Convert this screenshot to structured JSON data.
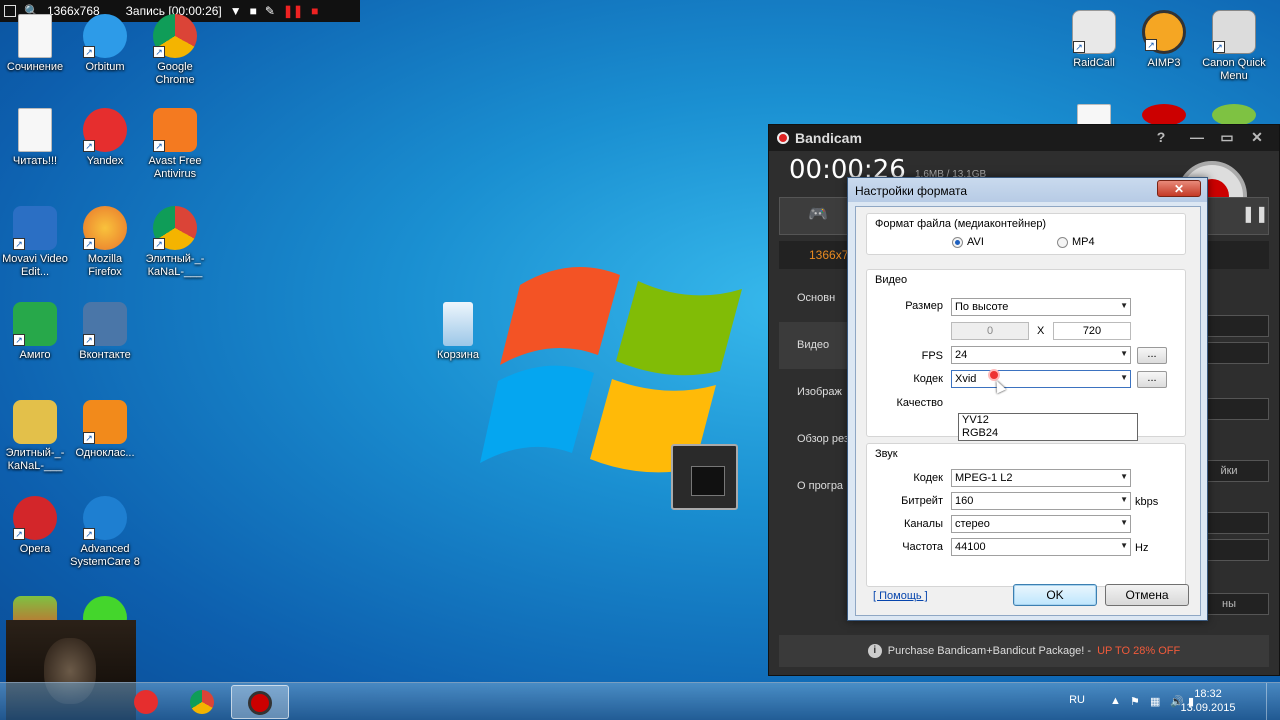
{
  "recorder": {
    "resolution": "1366x768",
    "status": "Запись [00:00:26]"
  },
  "desktop_icons": [
    {
      "label": "Сочинение",
      "icon": "document-icon",
      "color": "#e8eef7"
    },
    {
      "label": "Orbitum",
      "icon": "orbitum-icon",
      "color": "#2d9be8"
    },
    {
      "label": "Google Chrome",
      "icon": "chrome-icon",
      "color": "#3aa757"
    },
    {
      "label": "Читать!!!",
      "icon": "text-file-icon",
      "color": "#f7f7f7"
    },
    {
      "label": "Yandex",
      "icon": "yandex-icon",
      "color": "#e62e2e"
    },
    {
      "label": "Avast Free Antivirus",
      "icon": "avast-icon",
      "color": "#f47a20"
    },
    {
      "label": "Movavi Video Edit...",
      "icon": "movavi-icon",
      "color": "#2b6fc4"
    },
    {
      "label": "Mozilla Firefox",
      "icon": "firefox-icon",
      "color": "#e8752b"
    },
    {
      "label": "Элитный-_-КаNаL-___",
      "icon": "chrome-icon",
      "color": "#3aa757"
    },
    {
      "label": "Амиго",
      "icon": "amigo-icon",
      "color": "#27a84a"
    },
    {
      "label": "Вконтакте",
      "icon": "vk-icon",
      "color": "#4a76a8"
    },
    {
      "label": "Элитный-_-КаNаL-___",
      "icon": "folder-icon",
      "color": "#e3c04a"
    },
    {
      "label": "Однoклас...",
      "icon": "odnoklassniki-icon",
      "color": "#f28a1b"
    },
    {
      "label": "Opera",
      "icon": "opera-icon",
      "color": "#d3262a"
    },
    {
      "label": "Advanced SystemCare 8",
      "icon": "systemcare-icon",
      "color": "#1e7fd1"
    },
    {
      "label": "Корзина",
      "icon": "recycle-bin-icon",
      "color": "#cfe6f7"
    },
    {
      "label": "RaidCall",
      "icon": "raidcall-icon",
      "color": "#e8e8e8"
    },
    {
      "label": "AIMP3",
      "icon": "aimp-icon",
      "color": "#f5a623"
    },
    {
      "label": "Canon Quick Menu",
      "icon": "canon-icon",
      "color": "#dcdcdc"
    }
  ],
  "bandicam": {
    "title": "Bandicam",
    "timer": "00:00:26",
    "file_size": "1.6MB / 13.1GB",
    "mode_label": "1366x768",
    "side_items": [
      "Основн",
      "Видео",
      "Изображ",
      "Обзор резул",
      "О програ"
    ],
    "right_buttons": [
      "",
      "",
      "",
      "",
      "йки",
      "",
      "",
      "ны"
    ],
    "promo_text": "Purchase Bandicam+Bandicut Package! -",
    "promo_offer": "UP TO 28% OFF"
  },
  "dialog": {
    "title": "Настройки формата",
    "close": "✕",
    "file_format": {
      "group_title": "Формат файла (медиаконтейнер)",
      "options": [
        "AVI",
        "MP4"
      ],
      "selected": "AVI"
    },
    "video": {
      "group_title": "Видео",
      "size_label": "Размер",
      "size_value": "По высоте",
      "width": "0",
      "x_label": "X",
      "height": "720",
      "fps_label": "FPS",
      "fps_value": "24",
      "codec_label": "Кодек",
      "codec_value": "Xvid",
      "codec_options": [
        "YV12",
        "RGB24"
      ],
      "quality_label": "Качество",
      "dots": "..."
    },
    "audio": {
      "group_title": "Звук",
      "codec_label": "Кодек",
      "codec_value": "MPEG-1 L2",
      "bitrate_label": "Битрейт",
      "bitrate_value": "160",
      "bitrate_unit": "kbps",
      "channels_label": "Каналы",
      "channels_value": "стерео",
      "rate_label": "Частота",
      "rate_value": "44100",
      "rate_unit": "Hz"
    },
    "help_link": "[ Помощь ]",
    "ok": "OK",
    "cancel": "Отмена"
  },
  "taskbar": {
    "lang": "RU",
    "time": "18:32",
    "date": "13.09.2015"
  }
}
